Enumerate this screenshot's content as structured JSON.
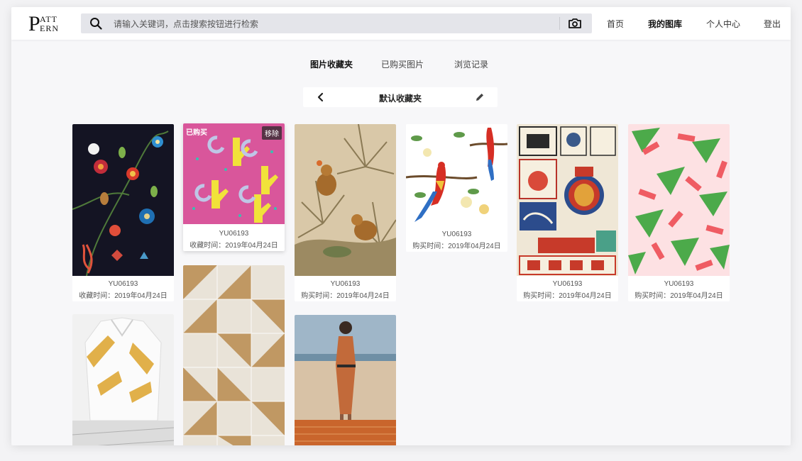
{
  "header": {
    "logo_big": "P",
    "logo_line1": "ATT",
    "logo_line2": "ERN",
    "search_placeholder": "请输入关键词，点击搜索按钮进行检索",
    "nav": [
      {
        "label": "首页"
      },
      {
        "label": "我的图库"
      },
      {
        "label": "个人中心"
      },
      {
        "label": "登出"
      }
    ]
  },
  "tabs": [
    {
      "label": "图片收藏夹"
    },
    {
      "label": "已购买图片"
    },
    {
      "label": "浏览记录"
    }
  ],
  "folder": {
    "title": "默认收藏夹"
  },
  "cards": [
    {
      "code": "YU06193",
      "date": "收藏时间：2019年04月24日"
    },
    {
      "code": "YU06193",
      "date": "收藏时间：2019年04月24日",
      "badge_left": "已购买",
      "badge_right": "移除"
    },
    {
      "code": "YU06193",
      "date": "购买时间：2019年04月24日"
    },
    {
      "code": "YU06193",
      "date": "购买时间：2019年04月24日"
    },
    {
      "code": "YU06193",
      "date": "购买时间：2019年04月24日"
    },
    {
      "code": "YU06193",
      "date": "购买时间：2019年04月24日"
    }
  ],
  "colors": {
    "accent": "#111111",
    "search_bg": "#e4e5ea",
    "page_bg": "#f7f7f9"
  }
}
